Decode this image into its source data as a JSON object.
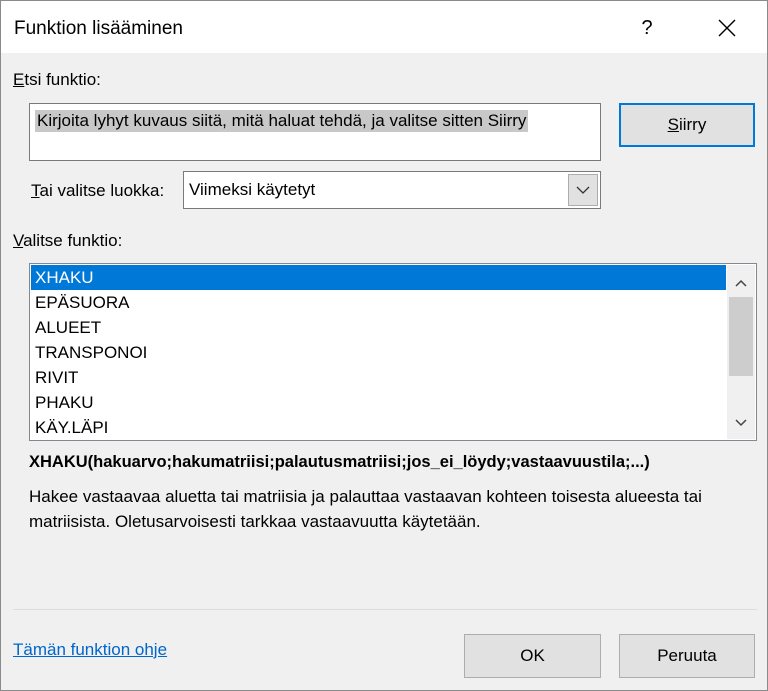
{
  "window": {
    "title": "Funktion lisääminen",
    "help_label": "?",
    "close_icon": "close-icon"
  },
  "search": {
    "label_accel": "E",
    "label_rest": "tsi funktio:",
    "value": "Kirjoita lyhyt kuvaus siitä, mitä haluat tehdä, ja valitse sitten Siirry",
    "go_accel": "S",
    "go_rest": "iirry"
  },
  "category": {
    "label_accel": "T",
    "label_rest": "ai valitse luokka:",
    "selected": "Viimeksi käytetyt",
    "arrow_icon": "chevron-down-icon"
  },
  "functions": {
    "label_accel": "V",
    "label_rest": "alitse funktio:",
    "items": [
      "XHAKU",
      "EPÄSUORA",
      "ALUEET",
      "TRANSPONOI",
      "RIVIT",
      "PHAKU",
      "KÄY.LÄPI"
    ],
    "selected_index": 0,
    "scroll_position": 0
  },
  "details": {
    "syntax": "XHAKU(hakuarvo;hakumatriisi;palautusmatriisi;jos_ei_löydy;vastaavuustila;...)",
    "description": "Hakee vastaavaa aluetta tai matriisia ja palauttaa vastaavan kohteen toisesta alueesta tai matriisista. Oletusarvoisesti tarkkaa vastaavuutta käytetään."
  },
  "footer": {
    "help_link": "Tämän funktion ohje",
    "ok_label": "OK",
    "cancel_label": "Peruuta"
  },
  "colors": {
    "accent": "#0078d7",
    "link": "#0066cc",
    "dialog_bg": "#f0f0f0"
  }
}
